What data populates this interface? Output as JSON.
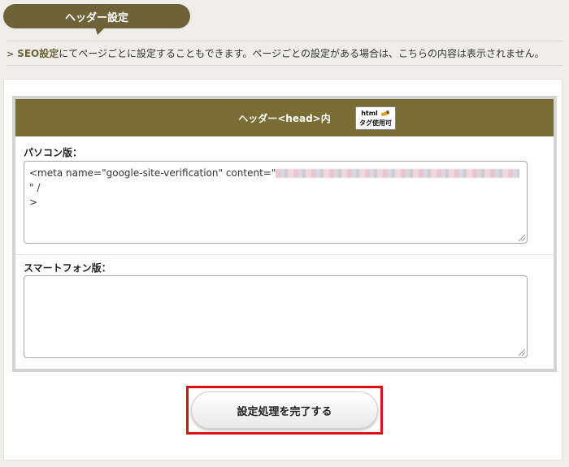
{
  "header_tab": {
    "label": "ヘッダー設定"
  },
  "notice": {
    "link_text": "SEO設定",
    "text": "にてページごとに設定することもできます。ページごとの設定がある場合は、こちらの内容は表示されません。"
  },
  "section": {
    "title": "ヘッダー<head>内",
    "badge": {
      "line1": "html",
      "line2": "タグ使用可",
      "icon": "pencil-icon"
    }
  },
  "pc": {
    "label": "パソコン版：",
    "value_prefix": "<meta name=\"google-site-verification\" content=\"",
    "value_suffix": "\" /",
    "value_line2": ">"
  },
  "sp": {
    "label": "スマートフォン版：",
    "value": ""
  },
  "submit_button": {
    "label": "設定処理を完了する"
  },
  "colors": {
    "accent": "#7a6c35",
    "highlight": "#e01010"
  }
}
